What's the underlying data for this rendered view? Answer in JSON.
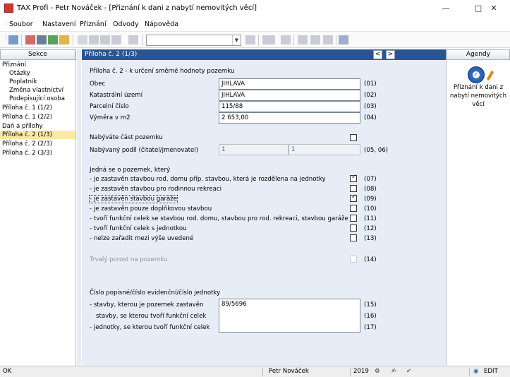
{
  "window": {
    "title": "TAX Profi - Petr Nováček - [Přiznání k dani z nabytí nemovitých věcí]",
    "controls": [
      "minimize-icon",
      "maximize-icon",
      "close-icon"
    ]
  },
  "menu": [
    "Soubor",
    "Nastavení",
    "Přiznání",
    "Odvody",
    "Nápověda"
  ],
  "toolbar": {
    "combo_value": "",
    "icons": [
      "open-icon",
      "save-icon",
      "print-preview-icon",
      "print-icon",
      "new-icon",
      "check-icon",
      "disk-icon",
      "disk-icon",
      "copy-icon",
      "folder-icon",
      "calculator-icon",
      "form-icon",
      "form-icon",
      "form-icon",
      "help-icon"
    ]
  },
  "sidebar": {
    "header": "Sekce",
    "items": [
      {
        "label": "Přiznání",
        "indent": 0
      },
      {
        "label": "Otázky",
        "indent": 1
      },
      {
        "label": "Poplatník",
        "indent": 1
      },
      {
        "label": "Změna vlastnictví",
        "indent": 1
      },
      {
        "label": "Podepisující osoba",
        "indent": 1
      },
      {
        "label": "Příloha č. 1 (1/2)",
        "indent": 0
      },
      {
        "label": "Příloha č. 1 (2/2)",
        "indent": 0
      },
      {
        "label": "Daň a přílohy",
        "indent": 0
      },
      {
        "label": "Příloha č. 2    (1/3)",
        "indent": 0,
        "selected": true
      },
      {
        "label": "Příloha č. 2    (2/3)",
        "indent": 0
      },
      {
        "label": "Příloha č. 2    (3/3)",
        "indent": 0
      }
    ]
  },
  "main": {
    "header": "Příloha č. 2    (1/3)",
    "nav_prev": "<",
    "nav_next": ">",
    "section_title": "Příloha č. 2 - k určení směrné hodnoty pozemku",
    "fields": [
      {
        "label": "Obec",
        "value": "JIHLAVA",
        "code": "(01)"
      },
      {
        "label": "Katastrální území",
        "value": "JIHLAVA",
        "code": "(02)"
      },
      {
        "label": "Parcelní číslo",
        "value": "115/88",
        "code": "(03)"
      },
      {
        "label": "Výměra v m2",
        "value": "2 653,00",
        "code": "(04)"
      }
    ],
    "partial": {
      "label": "Nabýváte část pozemku",
      "checked": false
    },
    "share": {
      "label": "Nabývaný podíl (čitatel/jmenovatel)",
      "num": "1",
      "den": "1",
      "code": "(05, 06)"
    },
    "land_heading": "Jedná se o pozemek, který",
    "land_options": [
      {
        "label": "- je zastavěn stavbou rod. domu příp. stavbou, která je rozdělena na jednotky",
        "checked": true,
        "code": "(07)"
      },
      {
        "label": "- je zastavěn stavbou pro rodinnou rekreaci",
        "checked": false,
        "code": "(08)"
      },
      {
        "label": "- je zastavěn stavbou garáže",
        "checked": true,
        "code": "(09)"
      },
      {
        "label": "- je zastavěn pouze doplňkovou stavbou",
        "checked": false,
        "code": "(10)"
      },
      {
        "label": "- tvoří funkční celek se stavbou rod. domu, stavbou pro rod. rekreaci, stavbou garáže",
        "checked": false,
        "code": "(11)"
      },
      {
        "label": "- tvoří funkční celek s jednotkou",
        "checked": false,
        "code": "(12)"
      },
      {
        "label": "- nelze zařadit mezi výše uvedené",
        "checked": false,
        "code": "(13)"
      }
    ],
    "cover": {
      "label": "Trvalý porost na pozemku",
      "code": "(14)"
    },
    "building_heading": "Číslo popisné/číslo evidenční/číslo jednotky",
    "building_rows": [
      {
        "label": "- stavby, kterou je pozemek zastavěn",
        "code": "(15)"
      },
      {
        "label": "  stavby, se kterou tvoří funkční celek",
        "code": "(16)"
      },
      {
        "label": "- jednotky, se kterou tvoří funkční celek",
        "code": "(17)"
      }
    ],
    "building_value": "89/5696"
  },
  "agendy": {
    "header": "Agendy",
    "item": "Přiznání k dani z nabytí nemovitých věcí"
  },
  "status": {
    "left": "OK",
    "user": "Petr Nováček",
    "year": "2019",
    "mode": "EDIT"
  }
}
